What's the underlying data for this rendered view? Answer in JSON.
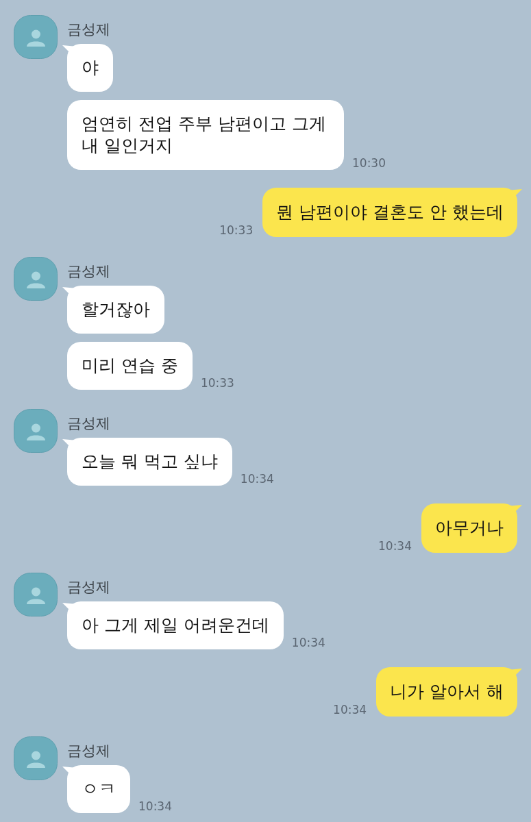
{
  "messages": [
    {
      "kind": "received",
      "sender": "금성제",
      "bubbles": [
        {
          "text": "야"
        },
        {
          "text": "엄연히 전업 주부 남편이고 그게 내 일인거지",
          "time": "10:30"
        }
      ]
    },
    {
      "kind": "sent",
      "bubbles": [
        {
          "text": "뭔 남편이야 결혼도 안 했는데",
          "time": "10:33"
        }
      ]
    },
    {
      "kind": "received",
      "sender": "금성제",
      "bubbles": [
        {
          "text": "할거잖아"
        },
        {
          "text": "미리 연습 중",
          "time": "10:33"
        }
      ]
    },
    {
      "kind": "received",
      "sender": "금성제",
      "bubbles": [
        {
          "text": "오늘 뭐 먹고 싶냐",
          "time": "10:34"
        }
      ]
    },
    {
      "kind": "sent",
      "bubbles": [
        {
          "text": "아무거나",
          "time": "10:34"
        }
      ]
    },
    {
      "kind": "received",
      "sender": "금성제",
      "bubbles": [
        {
          "text": "아 그게 제일 어려운건데",
          "time": "10:34"
        }
      ]
    },
    {
      "kind": "sent",
      "bubbles": [
        {
          "text": "니가 알아서 해",
          "time": "10:34"
        }
      ]
    },
    {
      "kind": "received",
      "sender": "금성제",
      "bubbles": [
        {
          "text": "ㅇㅋ",
          "time": "10:34"
        }
      ]
    }
  ]
}
